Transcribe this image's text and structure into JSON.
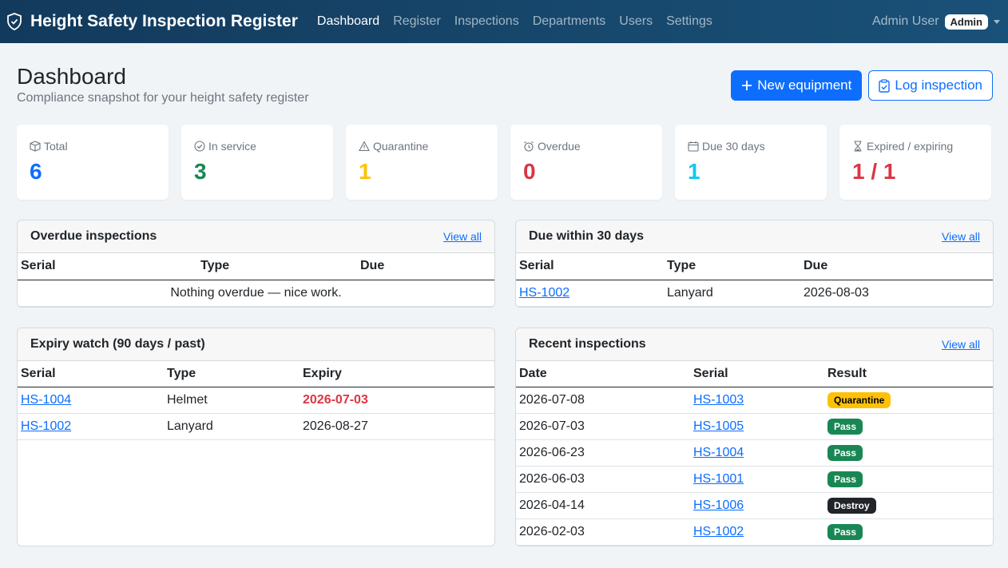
{
  "app": {
    "title": "Height Safety Inspection Register"
  },
  "nav": {
    "items": [
      "Dashboard",
      "Register",
      "Inspections",
      "Departments",
      "Users",
      "Settings"
    ],
    "user_name": "Admin User",
    "user_role": "Admin"
  },
  "header": {
    "title": "Dashboard",
    "subtitle": "Compliance snapshot for your height safety register",
    "new_button": "New equipment",
    "log_button": "Log inspection"
  },
  "stats": [
    {
      "label": "Total",
      "value": "6",
      "color": "#0d6efd",
      "icon": "box-icon"
    },
    {
      "label": "In service",
      "value": "3",
      "color": "#198754",
      "icon": "check-circle-icon"
    },
    {
      "label": "Quarantine",
      "value": "1",
      "color": "#ffc107",
      "icon": "warning-icon"
    },
    {
      "label": "Overdue",
      "value": "0",
      "color": "#dc3545",
      "icon": "alarm-icon"
    },
    {
      "label": "Due 30 days",
      "value": "1",
      "color": "#0dcaf0",
      "icon": "calendar-icon"
    },
    {
      "label": "Expired / expiring",
      "value": "1 / 1",
      "color": "#dc3545",
      "icon": "hourglass-icon"
    }
  ],
  "overdue": {
    "title": "Overdue inspections",
    "view_all": "View all",
    "columns": [
      "Serial",
      "Type",
      "Due"
    ],
    "empty": "Nothing overdue — nice work."
  },
  "due30": {
    "title": "Due within 30 days",
    "view_all": "View all",
    "columns": [
      "Serial",
      "Type",
      "Due"
    ],
    "rows": [
      {
        "serial": "HS-1002",
        "type": "Lanyard",
        "due": "2026-08-03"
      }
    ]
  },
  "expiry": {
    "title": "Expiry watch (90 days / past)",
    "columns": [
      "Serial",
      "Type",
      "Expiry"
    ],
    "rows": [
      {
        "serial": "HS-1004",
        "type": "Helmet",
        "expiry": "2026-07-03",
        "expired": true
      },
      {
        "serial": "HS-1002",
        "type": "Lanyard",
        "expiry": "2026-08-27",
        "expired": false
      }
    ]
  },
  "recent": {
    "title": "Recent inspections",
    "view_all": "View all",
    "columns": [
      "Date",
      "Serial",
      "Result"
    ],
    "rows": [
      {
        "date": "2026-07-08",
        "serial": "HS-1003",
        "result": "Quarantine"
      },
      {
        "date": "2026-07-03",
        "serial": "HS-1005",
        "result": "Pass"
      },
      {
        "date": "2026-06-23",
        "serial": "HS-1004",
        "result": "Pass"
      },
      {
        "date": "2026-06-03",
        "serial": "HS-1001",
        "result": "Pass"
      },
      {
        "date": "2026-04-14",
        "serial": "HS-1006",
        "result": "Destroy"
      },
      {
        "date": "2026-02-03",
        "serial": "HS-1002",
        "result": "Pass"
      }
    ]
  }
}
